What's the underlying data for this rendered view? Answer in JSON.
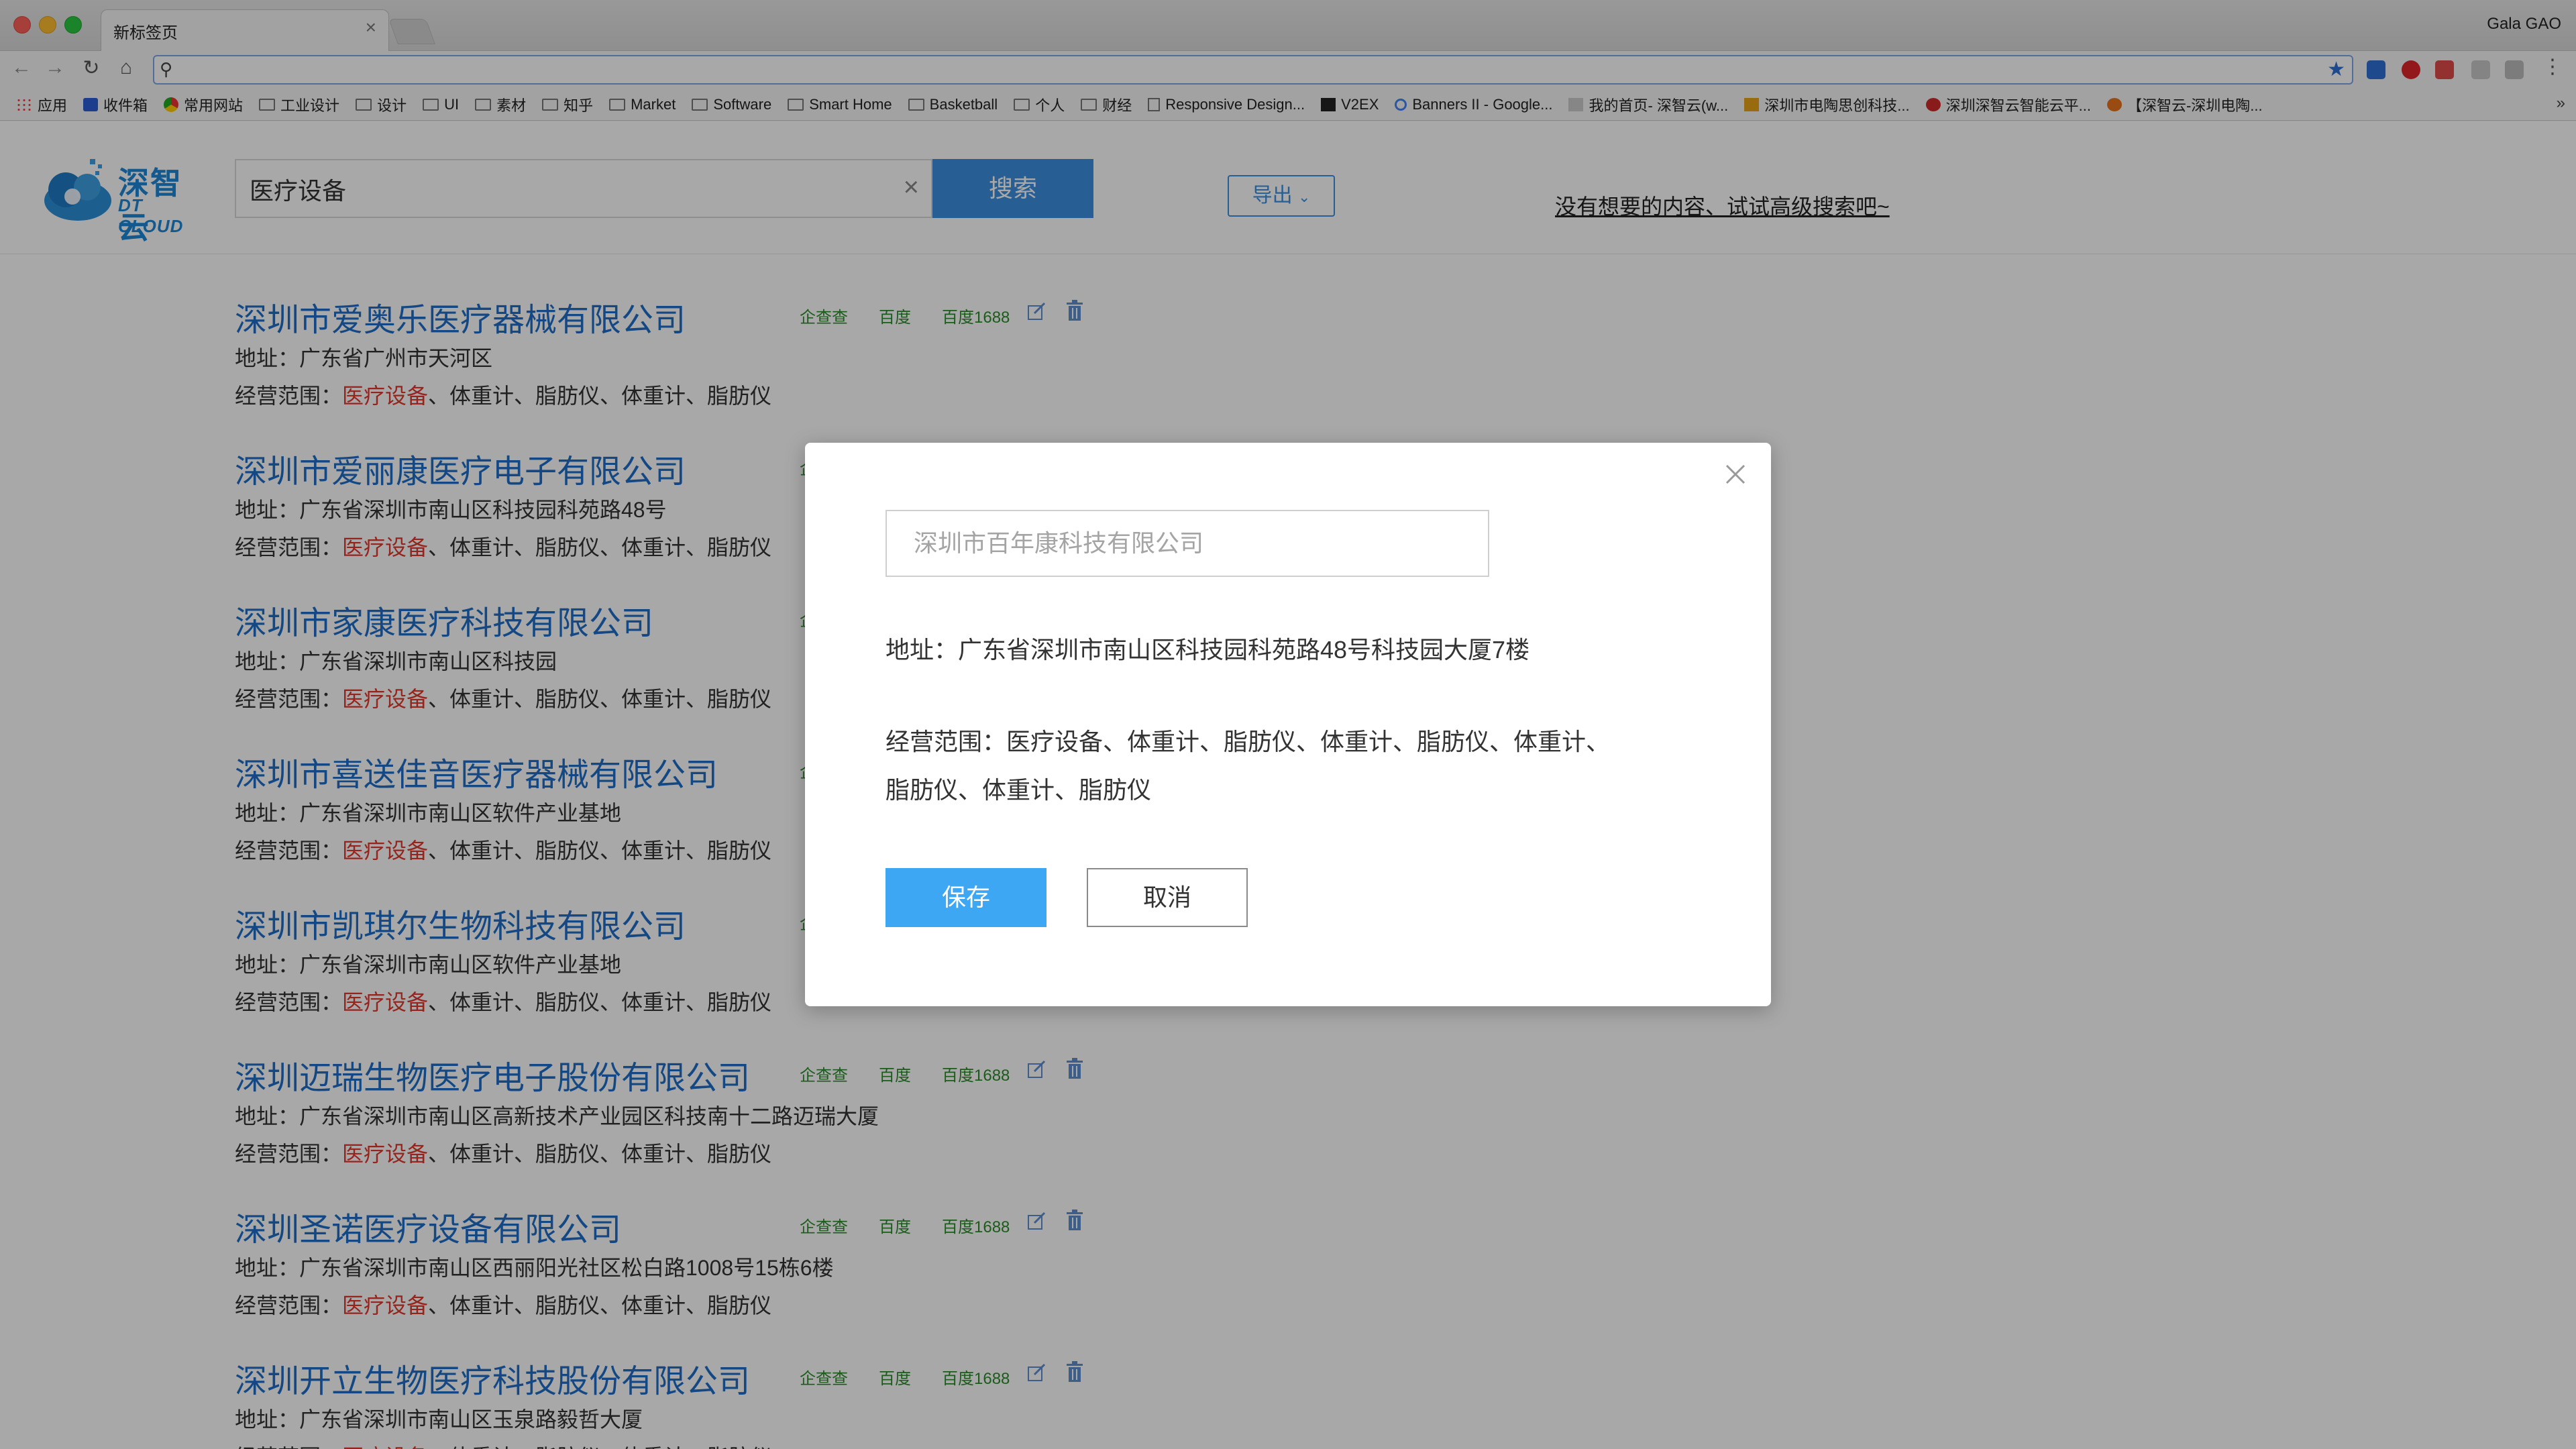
{
  "browser": {
    "tab_title": "新标签页",
    "tab_close": "×",
    "profile_name": "Gala GAO",
    "bookmarks": [
      "应用",
      "收件箱",
      "常用网站",
      "工业设计",
      "设计",
      "UI",
      "素材",
      "知乎",
      "Market",
      "Software",
      "Smart Home",
      "Basketball",
      "个人",
      "财经",
      "Responsive Design...",
      "V2EX",
      "Banners II - Google...",
      "我的首页- 深智云(w...",
      "深圳市电陶思创科技...",
      "深圳深智云智能云平...",
      "【深智云-深圳电陶..."
    ],
    "bookmarks_more": "»"
  },
  "header": {
    "logo_text": "深智云",
    "logo_sub": "DT CLOUD",
    "search_value": "医疗设备",
    "search_clear": "×",
    "search_button": "搜索",
    "export_button": "导出",
    "advanced_link": "没有想要的内容、试试高级搜索吧~"
  },
  "result_links": [
    "企查查",
    "百度",
    "百度1688"
  ],
  "scope_label": "经营范围：",
  "scope_highlight": "医疗设备",
  "scope_rest": "、体重计、脂肪仪、体重计、脂肪仪",
  "results": [
    {
      "title": "深圳市爱奥乐医疗器械有限公司",
      "address": "地址：广东省广州市天河区"
    },
    {
      "title": "深圳市爱丽康医疗电子有限公司",
      "address": "地址：广东省深圳市南山区科技园科苑路48号"
    },
    {
      "title": "深圳市家康医疗科技有限公司",
      "address": "地址：广东省深圳市南山区科技园"
    },
    {
      "title": "深圳市喜送佳音医疗器械有限公司",
      "address": "地址：广东省深圳市南山区软件产业基地"
    },
    {
      "title": "深圳市凯琪尔生物科技有限公司",
      "address": "地址：广东省深圳市南山区软件产业基地"
    },
    {
      "title": "深圳迈瑞生物医疗电子股份有限公司",
      "address": "地址：广东省深圳市南山区高新技术产业园区科技南十二路迈瑞大厦"
    },
    {
      "title": "深圳圣诺医疗设备有限公司",
      "address": "地址：广东省深圳市南山区西丽阳光社区松白路1008号15栋6楼"
    },
    {
      "title": "深圳开立生物医疗科技股份有限公司",
      "address": "地址：广东省深圳市南山区玉泉路毅哲大厦"
    }
  ],
  "modal": {
    "name_placeholder": "深圳市百年康科技有限公司",
    "address": "地址：广东省深圳市南山区科技园科苑路48号科技园大厦7楼",
    "scope_line1": "经营范围：医疗设备、体重计、脂肪仪、体重计、脂肪仪、体重计、",
    "scope_line2": "脂肪仪、体重计、脂肪仪",
    "save_button": "保存",
    "cancel_button": "取消"
  },
  "colors": {
    "brand_blue": "#3c8fe0",
    "link_blue": "#1e6ec8",
    "highlight_red": "#e2382d",
    "link_green": "#2a8c2a",
    "save_blue": "#3ea7f4"
  }
}
